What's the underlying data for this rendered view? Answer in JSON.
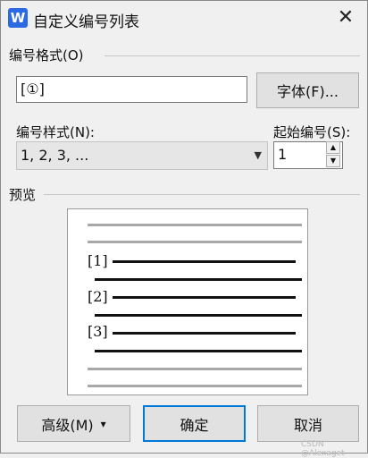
{
  "window": {
    "app_icon_letter": "W",
    "title": "自定义编号列表",
    "close_glyph": "✕"
  },
  "number_format": {
    "group_label": "编号格式(O)",
    "value": "[①]",
    "font_button": "字体(F)..."
  },
  "number_style": {
    "label": "编号样式(N):",
    "selected": "1, 2, 3, ...",
    "arrow_glyph": "▼"
  },
  "start_number": {
    "label": "起始编号(S):",
    "value": "1",
    "up_glyph": "▲",
    "down_glyph": "▼"
  },
  "preview": {
    "group_label": "预览",
    "items": [
      "[1]",
      "[2]",
      "[3]"
    ]
  },
  "buttons": {
    "advanced": "高级(M)",
    "advanced_glyph": "▾",
    "ok": "确定",
    "cancel": "取消"
  },
  "watermark": "CSDN @Alexaget",
  "colors": {
    "accent": "#0078d7",
    "app_icon": "#2b6ae5"
  }
}
